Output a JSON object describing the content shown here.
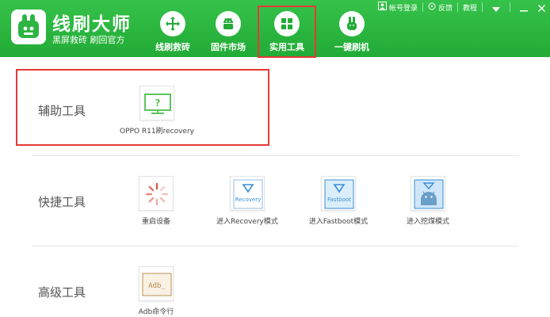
{
  "brand": {
    "title": "线刷大师",
    "subtitle": "黑屏救砖 刷回官方"
  },
  "nav": [
    {
      "label": "线刷救砖",
      "icon": "cross-arrows-icon"
    },
    {
      "label": "固件市场",
      "icon": "android-icon"
    },
    {
      "label": "实用工具",
      "icon": "grid-icon"
    },
    {
      "label": "一键刷机",
      "icon": "rabbit-icon"
    }
  ],
  "topbar": {
    "login_label": "帐号登录",
    "feedback_label": "反馈",
    "tutorial_label": "教程"
  },
  "sections": {
    "aux": {
      "title": "辅助工具",
      "tools": [
        {
          "label": "OPPO R11刷recovery",
          "icon": "monitor-question-icon",
          "tile_text": "?"
        }
      ]
    },
    "quick": {
      "title": "快捷工具",
      "tools": [
        {
          "label": "重启设备",
          "icon": "restart-spinner-icon"
        },
        {
          "label": "进入Recovery模式",
          "icon": "recovery-icon",
          "tile_text": "Recovery"
        },
        {
          "label": "进入Fastboot模式",
          "icon": "fastboot-icon",
          "tile_text": "Fastboot"
        },
        {
          "label": "进入挖煤模式",
          "icon": "android-download-icon"
        }
      ]
    },
    "advanced": {
      "title": "高级工具",
      "tools": [
        {
          "label": "Adb命令行",
          "icon": "adb-terminal-icon",
          "tile_text": "Adb_"
        }
      ]
    }
  },
  "colors": {
    "header_green": "#22ab36",
    "highlight_red": "#e53935",
    "tool_green": "#5cc45c",
    "tool_blue": "#3a8fd6",
    "tool_red": "#e05a4a",
    "adb_brown": "#c9a26b"
  }
}
